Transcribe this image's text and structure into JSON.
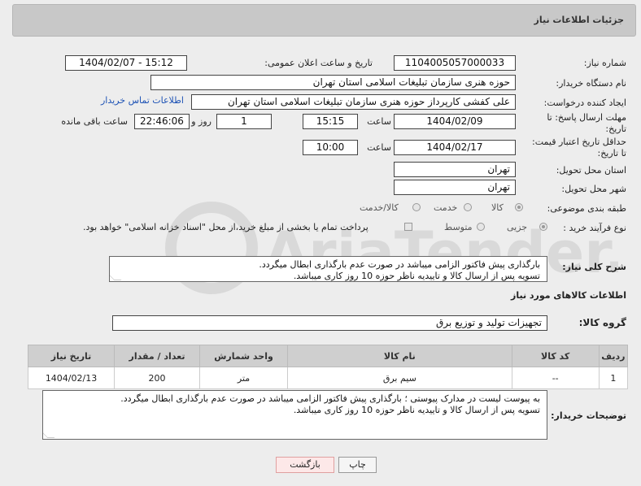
{
  "header": {
    "title": "جزئیات اطلاعات نیاز"
  },
  "fields": {
    "need_number_label": "شماره نیاز:",
    "need_number": "1104005057000033",
    "announce_label": "تاریخ و ساعت اعلان عمومی:",
    "announce_value": "1404/02/07 - 15:12",
    "buyer_org_label": "نام دستگاه خریدار:",
    "buyer_org": "حوزه هنری سازمان تبلیغات اسلامی استان تهران",
    "creator_label": "ایجاد کننده درخواست:",
    "creator": "علی کفشی کارپرداز حوزه هنری سازمان تبلیغات اسلامی استان تهران",
    "contact_link": "اطلاعات تماس خریدار",
    "deadline_label_1": "مهلت ارسال پاسخ: تا",
    "deadline_label_2": "تاریخ:",
    "deadline_date": "1404/02/09",
    "time_word": "ساعت",
    "deadline_time": "15:15",
    "days_count": "1",
    "day_and": "روز و",
    "remaining_time": "22:46:06",
    "remaining_label": "ساعت باقی مانده",
    "validity_label_1": "حداقل تاریخ اعتبار قیمت:",
    "validity_label_2": "تا تاریخ:",
    "validity_date": "1404/02/17",
    "validity_time": "10:00",
    "province_label": "استان محل تحویل:",
    "province": "تهران",
    "city_label": "شهر محل تحویل:",
    "city": "تهران",
    "category_label": "طبقه بندی موضوعی:",
    "category_options": [
      "کالا",
      "خدمت",
      "کالا/خدمت"
    ],
    "process_label": "نوع فرآیند خرید :",
    "process_options": [
      "جزیی",
      "متوسط"
    ],
    "payment_note": "پرداخت تمام یا بخشی از مبلغ خرید،از محل \"اسناد خزانه اسلامی\" خواهد بود."
  },
  "description": {
    "label": "شرح کلی نیاز:",
    "lines": [
      "بارگذاری پیش فاکتور الزامی میباشد در صورت عدم بارگذاری ابطال میگردد.",
      "تسویه پس از ارسال کالا و تاییدیه ناظر حوزه 10 روز کاری میباشد."
    ]
  },
  "goods": {
    "section_title": "اطلاعات کالاهای مورد نیاز",
    "group_label": "گروه کالا:",
    "group_value": "تجهیزات تولید و توزیع برق",
    "columns": [
      "ردیف",
      "کد کالا",
      "نام کالا",
      "واحد شمارش",
      "تعداد / مقدار",
      "تاریخ نیاز"
    ],
    "rows": [
      [
        "1",
        "--",
        "سیم برق",
        "متر",
        "200",
        "1404/02/13"
      ]
    ]
  },
  "buyer_notes": {
    "label": "توضیحات خریدار:",
    "lines": [
      "به پیوست لیست در مدارک پیوستی ؛ بارگذاری پیش فاکتور الزامی میباشد در صورت عدم بارگذاری ابطال میگردد.",
      "تسویه پس از ارسال کالا و تاییدیه ناظر حوزه 10 روز کاری میباشد."
    ]
  },
  "buttons": {
    "print": "چاپ",
    "back": "بازگشت"
  },
  "watermark_text": "AriaTender.net",
  "colors": {
    "link": "#1d52b5",
    "header_bg": "#c8c8c8",
    "back_button_bg": "#fde8e8"
  }
}
